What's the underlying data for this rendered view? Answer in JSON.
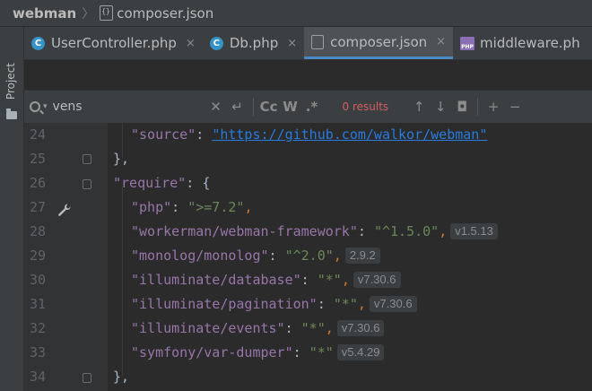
{
  "nav": {
    "project": "webman",
    "file": "composer.json"
  },
  "sidebar": {
    "label": "Project"
  },
  "tabs": [
    {
      "label": "UserController.php",
      "icon": "php-class-icon",
      "close": "×"
    },
    {
      "label": "Db.php",
      "icon": "php-class-icon",
      "close": "×"
    },
    {
      "label": "composer.json",
      "icon": "json-file-icon",
      "close": "×",
      "active": true
    },
    {
      "label": "middleware.ph",
      "icon": "php-file-icon"
    }
  ],
  "find": {
    "query": "vens",
    "case_label": "Cc",
    "word_label": "W",
    "regex_label": ".*",
    "results": "0 results"
  },
  "editor": {
    "lines": [
      {
        "n": "24",
        "key": "\"source\"",
        "sep": ": ",
        "url": "\"https://github.com/walkor/webman\""
      },
      {
        "n": "25",
        "text": "},"
      },
      {
        "n": "26",
        "key": "\"require\"",
        "sep": ": ",
        "text": "{"
      },
      {
        "n": "27",
        "key": "\"php\"",
        "sep": ": ",
        "val": "\">=7.2\"",
        "comma": ","
      },
      {
        "n": "28",
        "key": "\"workerman/webman-framework\"",
        "sep": ": ",
        "val": "\"^1.5.0\"",
        "comma": ",",
        "hint": "v1.5.13"
      },
      {
        "n": "29",
        "key": "\"monolog/monolog\"",
        "sep": ": ",
        "val": "\"^2.0\"",
        "comma": ",",
        "hint": "2.9.2"
      },
      {
        "n": "30",
        "key": "\"illuminate/database\"",
        "sep": ": ",
        "val": "\"*\"",
        "comma": ",",
        "hint": "v7.30.6"
      },
      {
        "n": "31",
        "key": "\"illuminate/pagination\"",
        "sep": ": ",
        "val": "\"*\"",
        "comma": ",",
        "hint": "v7.30.6"
      },
      {
        "n": "32",
        "key": "\"illuminate/events\"",
        "sep": ": ",
        "val": "\"*\"",
        "comma": ",",
        "hint": "v7.30.6"
      },
      {
        "n": "33",
        "key": "\"symfony/var-dumper\"",
        "sep": ": ",
        "val": "\"*\"",
        "hint": "v5.4.29"
      },
      {
        "n": "34",
        "text": "},"
      }
    ]
  }
}
